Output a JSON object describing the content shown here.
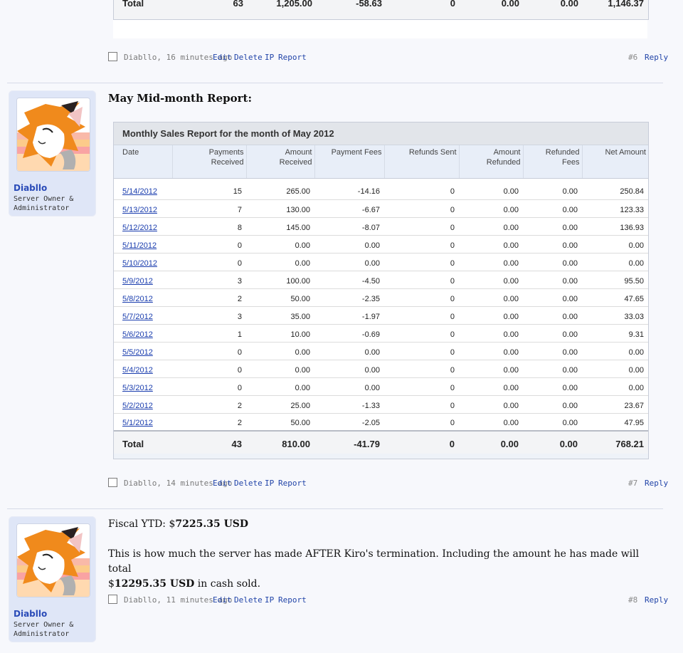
{
  "top_fragment": {
    "total_label": "Total",
    "cells": [
      "63",
      "1,205.00",
      "-58.63",
      "0",
      "0.00",
      "0.00",
      "1,146.37"
    ]
  },
  "post6": {
    "author_time": "Diabllo, 16 minutes ago",
    "edit": "Edit",
    "delete": "Delete",
    "ip": "IP",
    "report": "Report",
    "number": "#6",
    "reply": "Reply"
  },
  "post7": {
    "user": {
      "name": "Diabllo",
      "title": "Server Owner & Administrator"
    },
    "title": "May Mid-month Report:",
    "report": {
      "title": "Monthly Sales Report for the month of May 2012",
      "headers": [
        "Date",
        "Payments Received",
        "Amount Received",
        "Payment Fees",
        "Refunds Sent",
        "Amount Refunded",
        "Refunded Fees",
        "Net Amount"
      ],
      "rows": [
        [
          "5/14/2012",
          "15",
          "265.00",
          "-14.16",
          "0",
          "0.00",
          "0.00",
          "250.84"
        ],
        [
          "5/13/2012",
          "7",
          "130.00",
          "-6.67",
          "0",
          "0.00",
          "0.00",
          "123.33"
        ],
        [
          "5/12/2012",
          "8",
          "145.00",
          "-8.07",
          "0",
          "0.00",
          "0.00",
          "136.93"
        ],
        [
          "5/11/2012",
          "0",
          "0.00",
          "0.00",
          "0",
          "0.00",
          "0.00",
          "0.00"
        ],
        [
          "5/10/2012",
          "0",
          "0.00",
          "0.00",
          "0",
          "0.00",
          "0.00",
          "0.00"
        ],
        [
          "5/9/2012",
          "3",
          "100.00",
          "-4.50",
          "0",
          "0.00",
          "0.00",
          "95.50"
        ],
        [
          "5/8/2012",
          "2",
          "50.00",
          "-2.35",
          "0",
          "0.00",
          "0.00",
          "47.65"
        ],
        [
          "5/7/2012",
          "3",
          "35.00",
          "-1.97",
          "0",
          "0.00",
          "0.00",
          "33.03"
        ],
        [
          "5/6/2012",
          "1",
          "10.00",
          "-0.69",
          "0",
          "0.00",
          "0.00",
          "9.31"
        ],
        [
          "5/5/2012",
          "0",
          "0.00",
          "0.00",
          "0",
          "0.00",
          "0.00",
          "0.00"
        ],
        [
          "5/4/2012",
          "0",
          "0.00",
          "0.00",
          "0",
          "0.00",
          "0.00",
          "0.00"
        ],
        [
          "5/3/2012",
          "0",
          "0.00",
          "0.00",
          "0",
          "0.00",
          "0.00",
          "0.00"
        ],
        [
          "5/2/2012",
          "2",
          "25.00",
          "-1.33",
          "0",
          "0.00",
          "0.00",
          "23.67"
        ],
        [
          "5/1/2012",
          "2",
          "50.00",
          "-2.05",
          "0",
          "0.00",
          "0.00",
          "47.95"
        ]
      ],
      "total": [
        "Total",
        "43",
        "810.00",
        "-41.79",
        "0",
        "0.00",
        "0.00",
        "768.21"
      ]
    },
    "author_time": "Diabllo, 14 minutes ago",
    "edit": "Edit",
    "delete": "Delete",
    "ip": "IP",
    "report_link": "Report",
    "number": "#7",
    "reply": "Reply"
  },
  "post8": {
    "user": {
      "name": "Diabllo",
      "title": "Server Owner & Administrator"
    },
    "ytd_prefix": "Fiscal YTD: $",
    "ytd_amount": "7225.35 USD",
    "text_line1": "This is how much the server has made AFTER Kiro's termination. Including the amount he has made will total",
    "text_line2_prefix": "$",
    "text_line2_amount": "12295.35 USD",
    "text_line2_suffix": " in cash sold.",
    "author_time": "Diabllo, 11 minutes ago",
    "edit": "Edit",
    "delete": "Delete",
    "ip": "IP",
    "report": "Report",
    "number": "#8",
    "reply": "Reply"
  },
  "colors": {
    "link": "#2144a8",
    "username": "#2a4bb8",
    "userinfo_bg": "#dfe6f7"
  },
  "icons": [
    "avatar-fox-image",
    "checkbox-icon"
  ]
}
